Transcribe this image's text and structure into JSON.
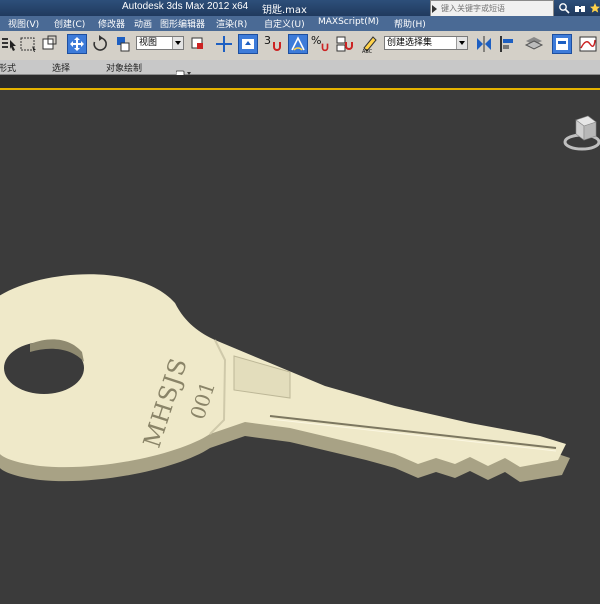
{
  "window": {
    "app_title": "Autodesk 3ds Max  2012 x64",
    "file_name": "钥匙.max",
    "search_placeholder": "键入关键字或短语"
  },
  "menu": {
    "items": [
      "视图(V)",
      "创建(C)",
      "修改器",
      "动画",
      "图形编辑器",
      "渲染(R)",
      "自定义(U)",
      "MAXScript(M)",
      "帮助(H)"
    ]
  },
  "toolbar": {
    "reference_coord": "视图",
    "selection_set": "创建选择集",
    "snap_label": "3",
    "percent_snap_label": "%"
  },
  "ribbon": {
    "tabs": [
      "形式",
      "选择",
      "对象绘制"
    ]
  },
  "viewport": {
    "key_text_1": "MHSJS",
    "key_text_2": "001",
    "colors": {
      "key": "#efe9c9",
      "key_shadow": "#a8a285",
      "background": "#3b3b3b"
    }
  }
}
